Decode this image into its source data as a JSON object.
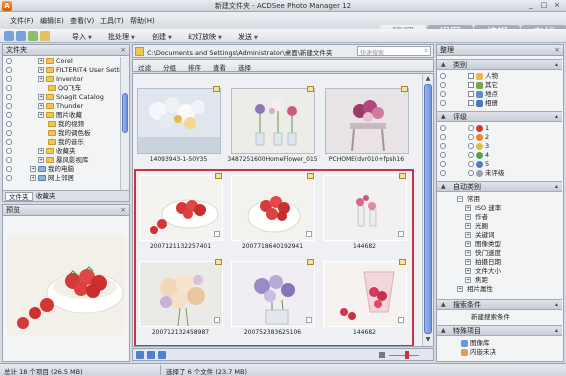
{
  "window": {
    "title": "新建文件夹 - ACDSee Photo Manager 12",
    "controls": [
      "_",
      "□",
      "×"
    ]
  },
  "menu": [
    "文件(F)",
    "编辑(E)",
    "查看(V)",
    "工具(T)",
    "帮助(H)"
  ],
  "modes": [
    "管理",
    "视图",
    "编辑",
    "在线"
  ],
  "toolbar": {
    "import": "导入",
    "batch": "批处理",
    "create": "创建",
    "slideshow": "幻灯放映",
    "send": "发送"
  },
  "folders_panel": {
    "title": "文件夹",
    "items": [
      "Corel",
      "FILTERIT4 User Setti",
      "Inventor",
      "QQ飞车",
      "SnagIt Catalog",
      "Thunder",
      "图片收藏",
      "我的视频",
      "我的调色板",
      "我的音乐",
      "收藏夹",
      "暴风影视库",
      "我的电脑",
      "网上邻居"
    ],
    "tabs": [
      "文件夹",
      "收藏夹"
    ]
  },
  "preview_panel": {
    "title": "预览"
  },
  "address": {
    "path": "C:\\Documents and Settings\\Administrator\\桌面\\新建文件夹",
    "search_placeholder": "快速搜索"
  },
  "filterbar": [
    "过滤",
    "分组",
    "排序",
    "查看",
    "选择"
  ],
  "thumbnails": [
    {
      "label": "14093943-1-50Y35",
      "selected": false
    },
    {
      "label": "3487251600HomeFlower_015",
      "selected": false
    },
    {
      "label": "PCHOME(dvr010+fpsh16",
      "selected": false
    },
    {
      "label": "2007121132257401",
      "selected": true
    },
    {
      "label": "2007718640192941",
      "selected": true
    },
    {
      "label": "144682",
      "selected": true
    },
    {
      "label": "200712132458987",
      "selected": true
    },
    {
      "label": "200752383625106",
      "selected": true
    },
    {
      "label": "144682",
      "selected": true
    }
  ],
  "organize_panel": {
    "title": "整理",
    "categories": {
      "title": "类别",
      "items": [
        "人物",
        "其它",
        "地点",
        "相册"
      ]
    },
    "ratings": {
      "title": "评级",
      "items": [
        "1",
        "2",
        "3",
        "4",
        "5",
        "未评级"
      ]
    },
    "auto_categories": {
      "title": "自动类别",
      "items": [
        "常用",
        "ISO 速率",
        "作者",
        "光圈",
        "关键词",
        "图像类型",
        "快门速度",
        "拍摄日期",
        "文件大小",
        "焦距",
        "相片属性"
      ]
    },
    "saved_searches": {
      "title": "搜索条件",
      "items": [
        "新建搜索条件"
      ]
    },
    "special_items": {
      "title": "特殊项目",
      "items": [
        "图像库",
        "内嵌未决"
      ]
    }
  },
  "status": {
    "total": "总计 18 个项目 (26.5 MB)",
    "selected": "选择了 6 个文件 (23.7 MB)"
  },
  "colors": {
    "selection_border": "#cc3340",
    "scroll_thumb": "#6f92d8",
    "window_bg": "#d6dae2"
  }
}
